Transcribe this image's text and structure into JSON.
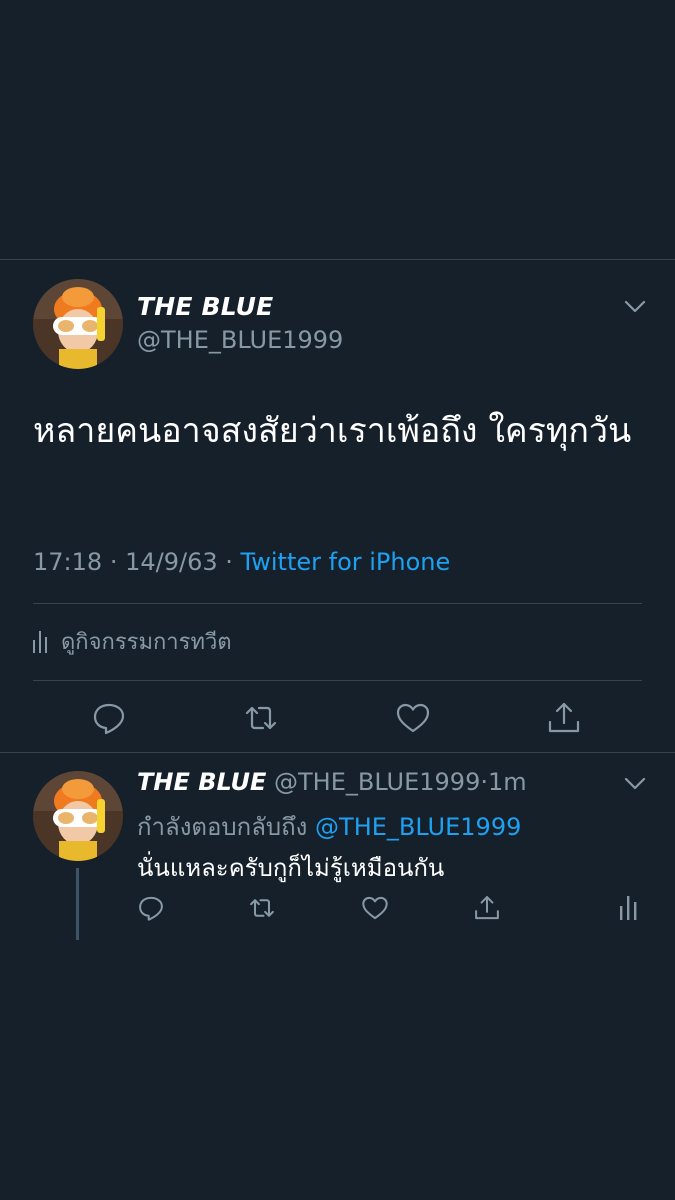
{
  "main_tweet": {
    "display_name": "THE BLUE",
    "handle": "@THE_BLUE1999",
    "text": "หลายคนอาจสงสัยว่าเราเพ้อถึง ใครทุกวัน",
    "time": "17:18",
    "date": "14/9/63",
    "separator": "·",
    "source": "Twitter for iPhone",
    "activity_label": "ดูกิจกรรมการทวีต",
    "actions": [
      "reply-icon",
      "retweet-icon",
      "like-icon",
      "share-icon"
    ]
  },
  "reply_tweet": {
    "display_name": "THE BLUE",
    "handle": "@THE_BLUE1999",
    "separator": "·",
    "age": "1m",
    "replying_label": "กำลังตอบกลับถึง",
    "replying_to": "@THE_BLUE1999",
    "text": "นั่นแหละครับกูก็ไม่รู้เหมือนกัน",
    "actions": [
      "reply-icon",
      "retweet-icon",
      "like-icon",
      "share-icon",
      "analytics-icon"
    ]
  },
  "colors": {
    "background": "#15202b",
    "divider": "#38444d",
    "secondary_text": "#8899a6",
    "link": "#1da1f2",
    "primary_text": "#ffffff"
  }
}
